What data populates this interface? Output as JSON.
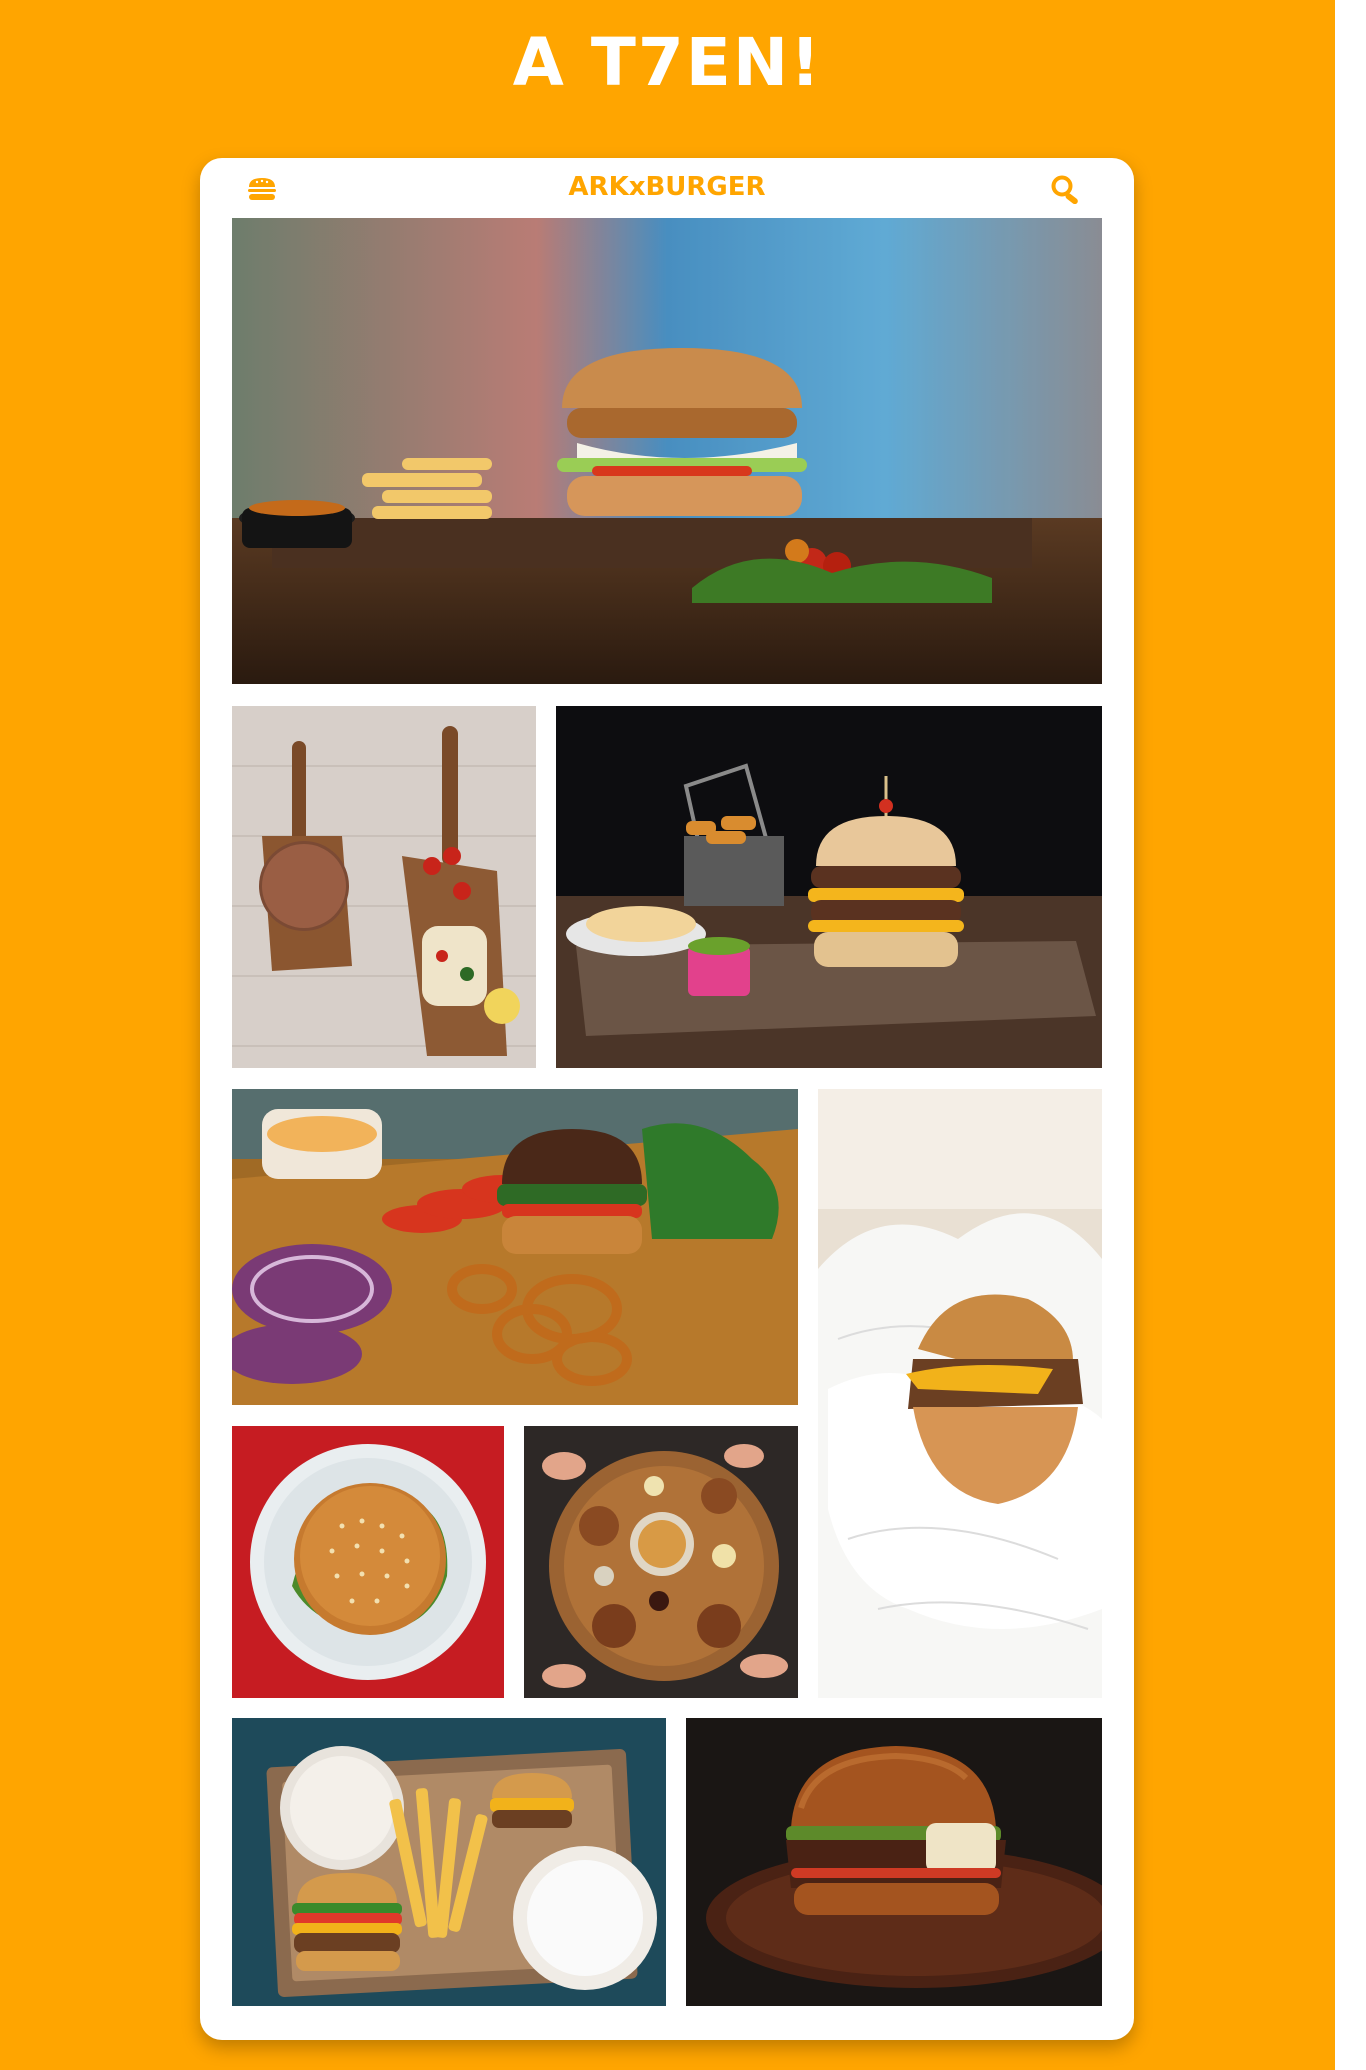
{
  "page": {
    "heading": "A T7EN!",
    "background_color": "#FFA500"
  },
  "app": {
    "brand": "ARKxBURGER",
    "accent_color": "#FFA500",
    "menu_icon": "burger-icon",
    "search_icon": "search-icon"
  },
  "gallery": [
    {
      "name": "burger-fries-board-photo"
    },
    {
      "name": "cutting-boards-photo"
    },
    {
      "name": "double-cheeseburger-photo"
    },
    {
      "name": "burger-onion-rings-photo"
    },
    {
      "name": "wrapped-burger-photo"
    },
    {
      "name": "burger-on-plate-photo"
    },
    {
      "name": "shared-table-photo"
    },
    {
      "name": "takeout-box-photo"
    },
    {
      "name": "brioche-burger-photo"
    }
  ]
}
